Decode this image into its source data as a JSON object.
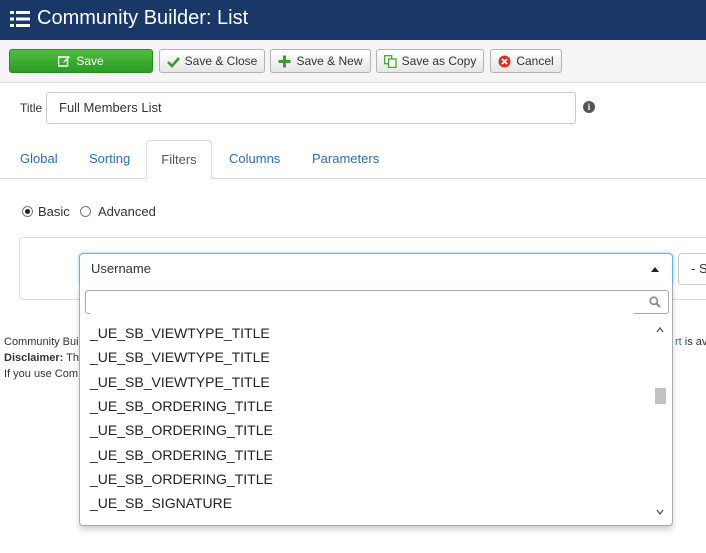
{
  "window": {
    "title": "Community Builder: List"
  },
  "toolbar": {
    "save": "Save",
    "save_close": "Save & Close",
    "save_new": "Save & New",
    "save_copy": "Save as Copy",
    "cancel": "Cancel"
  },
  "title_field": {
    "label": "Title",
    "value": "Full Members List"
  },
  "tabs": [
    {
      "label": "Global"
    },
    {
      "label": "Sorting"
    },
    {
      "label": "Filters"
    },
    {
      "label": "Columns"
    },
    {
      "label": "Parameters"
    }
  ],
  "active_tab": "Filters",
  "filter_mode": {
    "basic": "Basic",
    "advanced": "Advanced",
    "selected": "Basic"
  },
  "field_select": {
    "value": "Username",
    "second_value": "- S"
  },
  "footer": {
    "line1_start": "Community Bui",
    "line1_link": "rt",
    "line1_end": " is av",
    "line2_bold": "Disclaimer:",
    "line2_text": " Th",
    "line3": "If you use Com"
  },
  "dropdown": {
    "search_placeholder": "",
    "options": [
      "_UE_SB_VIEWTYPE_TITLE",
      "_UE_SB_VIEWTYPE_TITLE",
      "_UE_SB_VIEWTYPE_TITLE",
      "_UE_SB_ORDERING_TITLE",
      "_UE_SB_ORDERING_TITLE",
      "_UE_SB_ORDERING_TITLE",
      "_UE_SB_ORDERING_TITLE",
      "_UE_SB_SIGNATURE"
    ]
  },
  "colors": {
    "header_bg": "#1a3867",
    "save_green": "#3cae31",
    "link_blue": "#2a6fb6",
    "cancel_red": "#d9322b"
  }
}
